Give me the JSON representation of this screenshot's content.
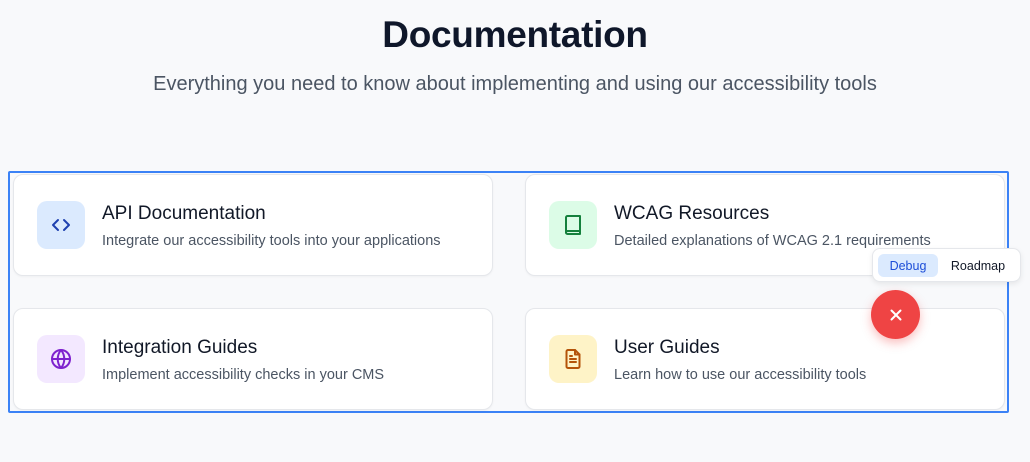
{
  "header": {
    "title": "Documentation",
    "subtitle": "Everything you need to know about implementing and using our accessibility tools"
  },
  "cards": [
    {
      "title": "API Documentation",
      "description": "Integrate our accessibility tools into your applications",
      "icon": "code-icon",
      "icon_color": "#1e40af",
      "icon_bg": "#dbeafe"
    },
    {
      "title": "WCAG Resources",
      "description": "Detailed explanations of WCAG 2.1 requirements",
      "icon": "book-icon",
      "icon_color": "#15803d",
      "icon_bg": "#dcfce7"
    },
    {
      "title": "Integration Guides",
      "description": "Implement accessibility checks in your CMS",
      "icon": "globe-icon",
      "icon_color": "#7e22ce",
      "icon_bg": "#f3e8ff"
    },
    {
      "title": "User Guides",
      "description": "Learn how to use our accessibility tools",
      "icon": "file-text-icon",
      "icon_color": "#b45309",
      "icon_bg": "#fef3c7"
    }
  ],
  "debug_toolbar": {
    "debug_label": "Debug",
    "roadmap_label": "Roadmap"
  },
  "fab": {
    "icon": "close-icon",
    "color": "#ef4444"
  },
  "colors": {
    "accent": "#3b82f6",
    "background": "#f8f9fb"
  }
}
